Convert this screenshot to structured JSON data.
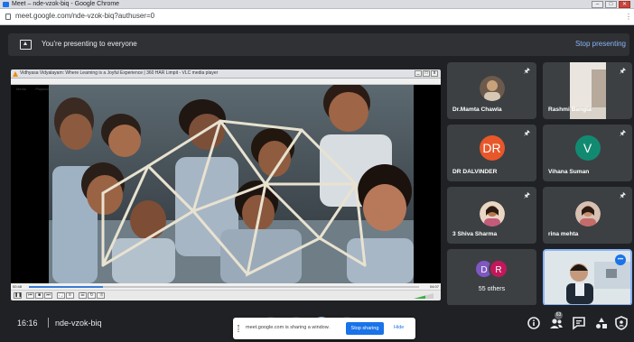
{
  "browser": {
    "window_title": "Meet – nde-vzok-biq - Google Chrome",
    "url": "meet.google.com/nde-vzok-biq?authuser=0",
    "window_buttons": [
      "–",
      "□",
      "✕"
    ]
  },
  "banner": {
    "message": "You're presenting to everyone",
    "stop_label": "Stop presenting"
  },
  "vlc": {
    "title": "Vidhyasa Vidyalayam: Where Learning is a Joyful Experience | 360 HAR Limpit - VLC media player",
    "menu": [
      "Media",
      "Playback",
      "Audio",
      "Video",
      "Subtitle",
      "Tools",
      "View",
      "Help"
    ],
    "time_elapsed": "00:48",
    "time_total": "04:07",
    "progress": 0.19
  },
  "participants": [
    {
      "name": "Dr.Mamta Chawla",
      "type": "photo",
      "color": "#c9a27a"
    },
    {
      "name": "Rashmi Bangia",
      "type": "photo",
      "color": "#b7a99b"
    },
    {
      "name": "DR DALVINDER",
      "type": "letter",
      "letter": "DR",
      "color": "#e8572a"
    },
    {
      "name": "Vihana Suman",
      "type": "letter",
      "letter": "V",
      "color": "#128a72"
    },
    {
      "name": "3 Shiva Sharma",
      "type": "photo",
      "color": "#b5784f"
    },
    {
      "name": "rina mehta",
      "type": "photo",
      "color": "#c46b6b"
    }
  ],
  "others": {
    "d": "D",
    "r": "R",
    "label": "55 others"
  },
  "self_tile": {
    "more_icon": "•••"
  },
  "bottom": {
    "time": "16:16",
    "meeting_code": "nde-vzok-biq",
    "people_count": "63"
  },
  "share_popup": {
    "message": "meet.google.com is sharing a window.",
    "stop_label": "Stop sharing",
    "hide_label": "Hide"
  },
  "colors": {
    "meet_bg": "#202124",
    "tile_bg": "#3c4043",
    "accent": "#8ab4f8",
    "primary_blue": "#1a73e8"
  },
  "icons": [
    "lock-icon",
    "present-icon",
    "pin-icon",
    "info-icon",
    "people-icon",
    "chat-icon",
    "activities-icon",
    "host-controls-icon"
  ]
}
